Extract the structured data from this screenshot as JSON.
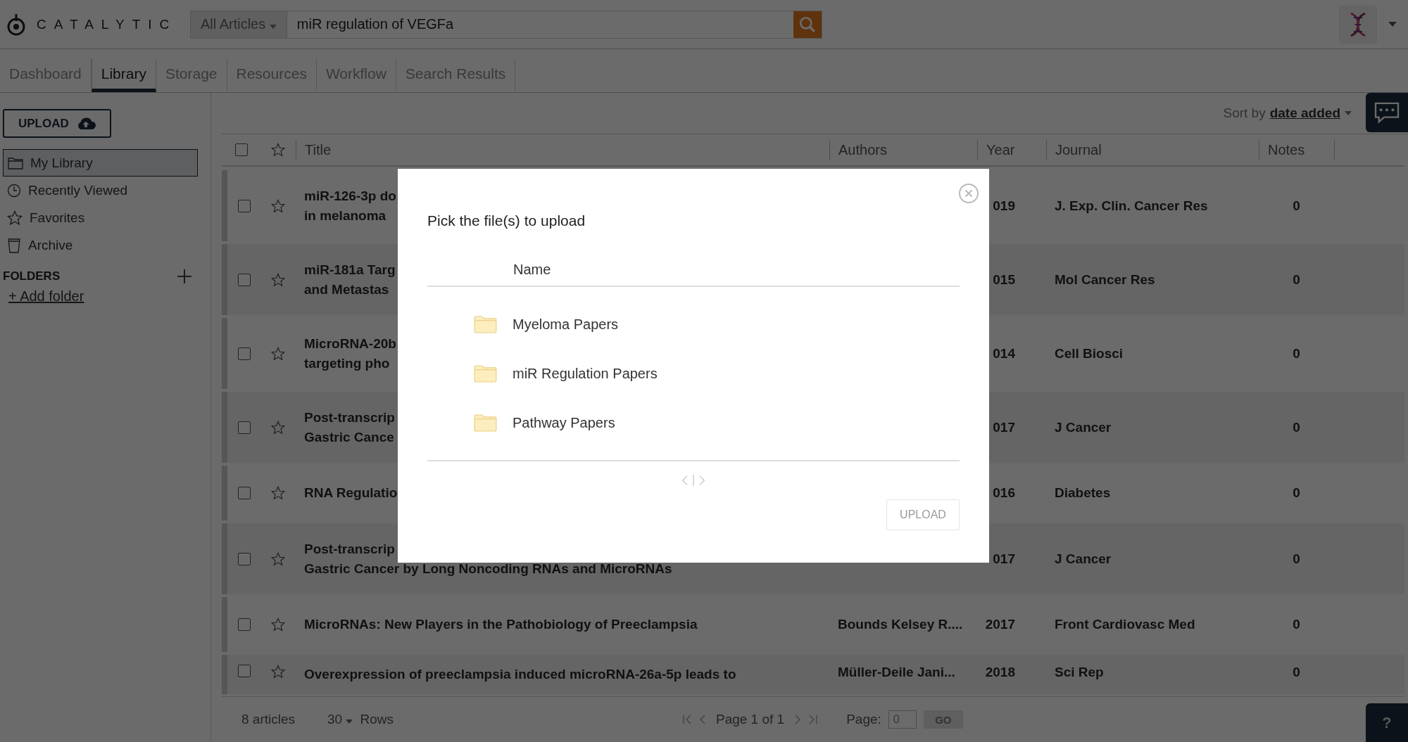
{
  "brand": {
    "name": "CATALYTIC"
  },
  "search": {
    "scope": "All Articles",
    "value": "miR regulation of VEGFa"
  },
  "tabs": [
    {
      "label": "Dashboard",
      "selected": false
    },
    {
      "label": "Library",
      "selected": true
    },
    {
      "label": "Storage",
      "selected": false
    },
    {
      "label": "Resources",
      "selected": false
    },
    {
      "label": "Workflow",
      "selected": false
    },
    {
      "label": "Search Results",
      "selected": false
    }
  ],
  "sidebar": {
    "upload_button": "UPLOAD",
    "items": [
      {
        "label": "My Library",
        "kind": "library",
        "selected": true
      },
      {
        "label": "Recently Viewed",
        "kind": "recent",
        "selected": false
      },
      {
        "label": "Favorites",
        "kind": "favorites",
        "selected": false
      },
      {
        "label": "Archive",
        "kind": "archive",
        "selected": false
      }
    ],
    "folders_heading": "FOLDERS",
    "add_folder": "+ Add folder"
  },
  "sort": {
    "label": "Sort by",
    "value": "date added"
  },
  "table": {
    "select_all_checked": false,
    "columns": [
      "Title",
      "Authors",
      "Year",
      "Journal",
      "Notes"
    ],
    "rows": [
      {
        "title_lines": [
          "miR-126-3p do",
          "in melanoma"
        ],
        "year": "019",
        "journal": "J. Exp. Clin. Cancer Res",
        "notes": "0",
        "checked": false,
        "starred": false
      },
      {
        "title_lines": [
          "miR-181a Targ",
          "and Metastas"
        ],
        "year": "015",
        "journal": "Mol Cancer Res",
        "notes": "0",
        "checked": false,
        "starred": false
      },
      {
        "title_lines": [
          "MicroRNA-20b",
          "targeting pho"
        ],
        "year": "014",
        "journal": "Cell Biosci",
        "notes": "0",
        "checked": false,
        "starred": false
      },
      {
        "title_lines": [
          "Post-transcrip",
          "Gastric Cance"
        ],
        "year": "017",
        "journal": "J Cancer",
        "notes": "0",
        "checked": false,
        "starred": false
      },
      {
        "title_lines": [
          "RNA Regulatio"
        ],
        "year": "016",
        "journal": "Diabetes",
        "notes": "0",
        "checked": false,
        "starred": false
      },
      {
        "title_lines": [
          "Post-transcrip",
          "Gastric Cancer by Long Noncoding RNAs and MicroRNAs"
        ],
        "year": "017",
        "journal": "J Cancer",
        "notes": "0",
        "checked": false,
        "starred": false
      },
      {
        "title_lines": [
          "MicroRNAs: New Players in the Pathobiology of Preeclampsia"
        ],
        "authors": "Bounds Kelsey R....",
        "year": "2017",
        "journal": "Front Cardiovasc Med",
        "notes": "0",
        "checked": false,
        "starred": false
      },
      {
        "title_lines": [
          "Overexpression of preeclampsia induced microRNA-26a-5p leads to"
        ],
        "authors": "Müller-Deile Jani...",
        "year": "2018",
        "journal": "Sci Rep",
        "notes": "0",
        "checked": false,
        "starred": false
      }
    ]
  },
  "footer": {
    "count": "8 articles",
    "rows_value": "30",
    "rows_label": "Rows",
    "page_text": "Page 1 of 1",
    "page_label": "Page:",
    "page_value": "0",
    "go": "GO"
  },
  "help_button": "?",
  "modal": {
    "title": "Pick the file(s) to upload",
    "column": "Name",
    "folders": [
      {
        "name": "Myeloma Papers"
      },
      {
        "name": "miR Regulation Papers"
      },
      {
        "name": "Pathway Papers"
      }
    ],
    "pager_disabled": true,
    "upload_button": {
      "label": "UPLOAD",
      "disabled": true
    }
  }
}
